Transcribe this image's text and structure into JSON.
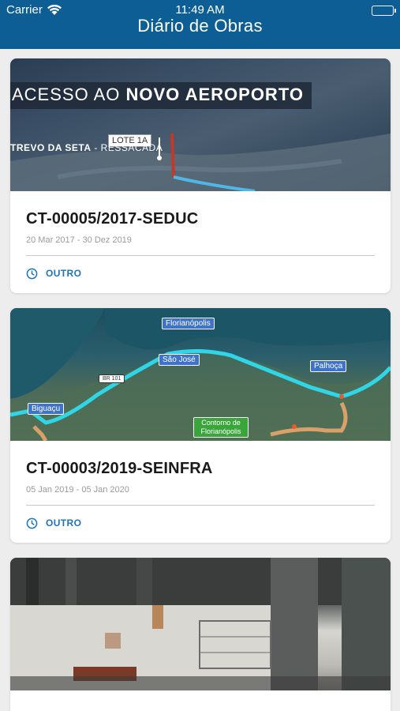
{
  "status_bar": {
    "carrier": "Carrier",
    "time": "11:49 AM"
  },
  "header": {
    "title": "Diário de Obras"
  },
  "cards": [
    {
      "title": "CT-00005/2017-SEDUC",
      "dates": "20 Mar 2017 - 30 Dez 2019",
      "type": "OUTRO",
      "image": {
        "headline_prefix": "ACESSO AO ",
        "headline_bold": "NOVO AEROPORTO",
        "lote": "LOTE 1A",
        "place_bold": "TREVO DA SETA",
        "place_rest": " - RESSACADA"
      }
    },
    {
      "title": "CT-00003/2019-SEINFRA",
      "dates": "05 Jan 2019 - 05 Jan 2020",
      "type": "OUTRO",
      "image": {
        "labels": [
          "Florianópolis",
          "São José",
          "Palhoça",
          "Biguaçu",
          "Contorno de Florianópolis",
          "BR 101"
        ]
      }
    },
    {
      "title": "",
      "dates": "",
      "type": ""
    }
  ],
  "colors": {
    "header": "#0d5e95",
    "accent": "#1e73be"
  }
}
